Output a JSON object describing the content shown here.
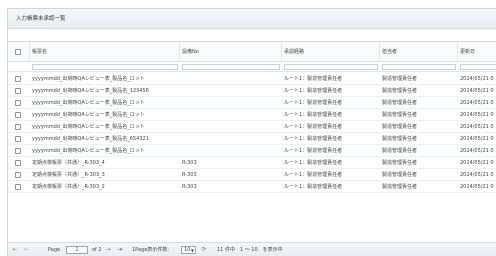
{
  "panel": {
    "title": "入力帳票未承認一覧"
  },
  "columns": {
    "name": "帳票名",
    "doc_no": "設備No",
    "route": "承認経路",
    "person": "担当者",
    "date": "更新日"
  },
  "rows": [
    {
      "name": "yyyymmdd_出荷時QAレビュー表_製品名_ロット",
      "doc_no": "",
      "route": "ルート1：製造管理責任者",
      "person": "製造管理責任者",
      "date": "2024/05/21 0"
    },
    {
      "name": "yyyymmdd_出荷時QAレビュー表_製品名_123456",
      "doc_no": "",
      "route": "ルート1：製造管理責任者",
      "person": "製造管理責任者",
      "date": "2024/05/21 0"
    },
    {
      "name": "yyyymmdd_出荷時QAレビュー表_製品名_ロット",
      "doc_no": "",
      "route": "ルート1：製造管理責任者",
      "person": "製造管理責任者",
      "date": "2024/05/21 0"
    },
    {
      "name": "yyyymmdd_出荷時QAレビュー表_製品名_ロット",
      "doc_no": "",
      "route": "ルート1：製造管理責任者",
      "person": "製造管理責任者",
      "date": "2024/05/21 0"
    },
    {
      "name": "yyyymmdd_出荷時QAレビュー表_製品名_ロット",
      "doc_no": "",
      "route": "ルート1：製造管理責任者",
      "person": "製造管理責任者",
      "date": "2024/05/21 0"
    },
    {
      "name": "yyyymmdd_出荷時QAレビュー表_製品名_654321",
      "doc_no": "",
      "route": "ルート1：製造管理責任者",
      "person": "製造管理責任者",
      "date": "2024/05/21 0"
    },
    {
      "name": "yyyymmdd_出荷時QAレビュー表_製品名_ロット",
      "doc_no": "",
      "route": "ルート1：製造管理責任者",
      "person": "製造管理責任者",
      "date": "2024/05/21 0"
    },
    {
      "name": "定期点検帳票（共通）_R-303_4",
      "doc_no": "R-303",
      "route": "ルート1：製造管理責任者",
      "person": "製造管理責任者",
      "date": "2024/05/21 0"
    },
    {
      "name": "定期点検帳票（共通）_R-303_3",
      "doc_no": "R-303",
      "route": "ルート1：製造管理責任者",
      "person": "製造管理責任者",
      "date": "2024/05/21 0"
    },
    {
      "name": "定期点検帳票（共通）_R-303_2",
      "doc_no": "R-303",
      "route": "ルート1：製造管理責任者",
      "person": "製造管理責任者",
      "date": "2024/05/21 0"
    }
  ],
  "footer": {
    "page_label": "Page",
    "page_value": "1",
    "of_label": "of 2",
    "per_page_label": "1Page表示件数:",
    "per_page_value": "10",
    "summary": "11 件中　1 ～ 10　を表示中"
  },
  "icons": {
    "first": "first-page-icon",
    "prev": "prev-page-icon",
    "next": "next-page-icon",
    "last": "last-page-icon",
    "refresh": "refresh-icon"
  }
}
